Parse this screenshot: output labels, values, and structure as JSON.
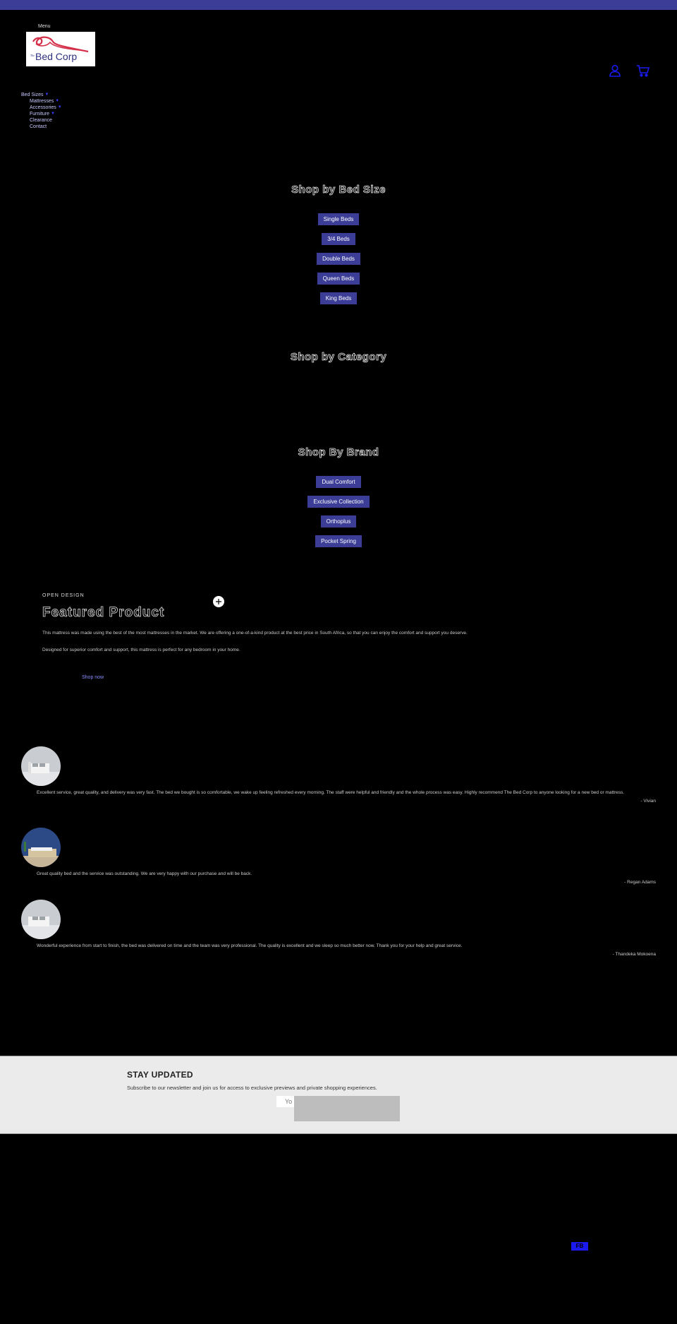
{
  "header": {
    "menu_label": "Menu",
    "logo_alt": "The Bed Corp",
    "logo_text": "Bed Corp",
    "logo_prefix": "The",
    "icons": [
      "account-icon",
      "cart-icon"
    ]
  },
  "nav": {
    "items": [
      {
        "label": "Bed Sizes",
        "has_children": true,
        "level": 0
      },
      {
        "label": "Mattresses",
        "has_children": true,
        "level": 1
      },
      {
        "label": "Accessories",
        "has_children": true,
        "level": 1
      },
      {
        "label": "Furniture",
        "has_children": true,
        "level": 1
      },
      {
        "label": "Clearance",
        "has_children": false,
        "level": 1
      },
      {
        "label": "Contact",
        "has_children": false,
        "level": 1
      }
    ]
  },
  "bed_size": {
    "title": "Shop by Bed Size",
    "buttons": [
      "Single Beds",
      "3/4 Beds",
      "Double Beds",
      "Queen Beds",
      "King Beds"
    ]
  },
  "category": {
    "title": "Shop by Category"
  },
  "brand": {
    "title": "Shop By Brand",
    "buttons": [
      "Dual Comfort",
      "Exclusive Collection",
      "Orthoplus",
      "Pocket Spring"
    ]
  },
  "featured": {
    "eyebrow": "OPEN DESIGN",
    "heading": "Featured Product",
    "paragraphs": [
      "This mattress was made using the best of the most mattresses in the market. We are offering a one-of-a-kind product at the best price in South Africa, so that you can enjoy the comfort and support you deserve.",
      "Designed for superior comfort and support, this mattress is perfect for any bedroom in your home."
    ],
    "link_label": "Shop now"
  },
  "testimonials": [
    {
      "quote": "Excellent service, great quality, and delivery was very fast. The bed we bought is so comfortable, we wake up feeling refreshed every morning. The staff were helpful and friendly and the whole process was easy. Highly recommend The Bed Corp to anyone looking for a new bed or mattress.",
      "author": "- Vivian"
    },
    {
      "quote": "Great quality bed and the service was outstanding. We are very happy with our purchase and will be back.",
      "author": "- Regan Adams"
    },
    {
      "quote": "Wonderful experience from start to finish, the bed was delivered on time and the team was very professional. The quality is excellent and we sleep so much better now. Thank you for your help and great service.",
      "author": "- Thandeka Mokoena"
    }
  ],
  "newsletter": {
    "title": "STAY UPDATED",
    "text": "Subscribe to our newsletter and join us for access to exclusive previews and private shopping experiences.",
    "input_placeholder": "Your email",
    "input_visible": "Yo",
    "submit_label": ""
  },
  "footer": {
    "badge": "FB"
  },
  "colors": {
    "brand": "#3b3d96",
    "icon_blue": "#1a1aee",
    "newsletter_bg": "#ebebeb"
  }
}
